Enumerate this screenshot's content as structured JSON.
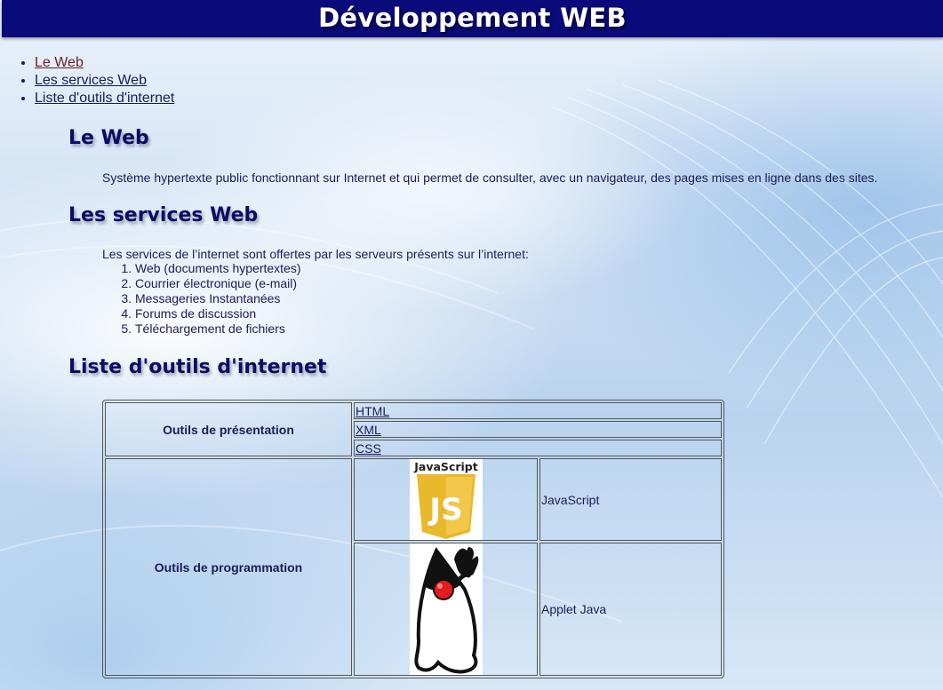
{
  "header": {
    "title": "Développement WEB"
  },
  "nav": {
    "items": [
      "Le Web",
      "Les services Web",
      "Liste d'outils d'internet"
    ]
  },
  "sections": {
    "web": {
      "heading": "Le Web",
      "text": "Système hypertexte public fonctionnant sur Internet et qui permet de consulter, avec un navigateur, des pages mises en ligne dans des sites."
    },
    "services": {
      "heading": "Les services Web",
      "intro": "Les services de l’internet sont offertes par les serveurs présents sur l’internet:",
      "items": [
        "Web (documents hypertextes)",
        "Courrier électronique (e-mail)",
        "Messageries Instantanées",
        "Forums de discussion",
        "Téléchargement de fichiers"
      ]
    },
    "tools": {
      "heading": "Liste d'outils d'internet"
    }
  },
  "table": {
    "presentation": {
      "label": "Outils de présentation",
      "links": [
        "HTML",
        "XML",
        "CSS"
      ]
    },
    "programming": {
      "label": "Outils de programmation",
      "rows": [
        {
          "logo_text": "JavaScript",
          "logo_badge": "JS",
          "name": "JavaScript"
        },
        {
          "name": "Applet Java"
        }
      ]
    }
  },
  "colors": {
    "header_bg": "#0a0a7a",
    "heading": "#0c0c66",
    "text": "#1c1c55",
    "visited_link": "#6b1f1f",
    "js_yellow": "#e8b92c"
  },
  "icons": [
    "javascript-logo-icon",
    "java-duke-mascot-icon"
  ]
}
